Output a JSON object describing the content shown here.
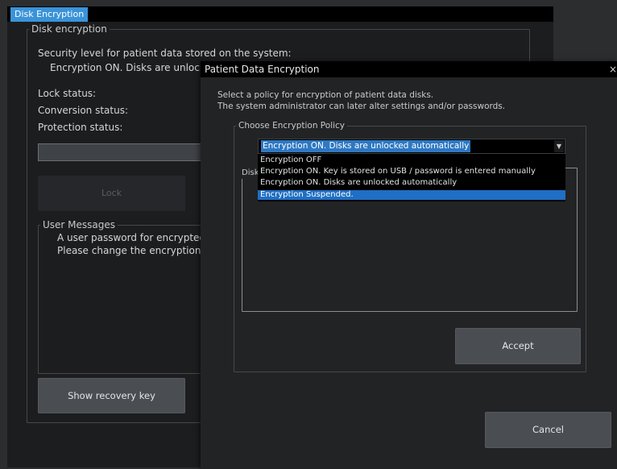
{
  "main_window": {
    "tab_label": "Disk Encryption",
    "group_title": "Disk encryption",
    "security_level_label": "Security level for patient data stored on the system:",
    "security_level_value": "Encryption ON. Disks are unlock",
    "lock_status_label": "Lock status:",
    "conversion_status_label": "Conversion status:",
    "protection_status_label": "Protection status:",
    "password_input_value": "",
    "lock_button": "Lock",
    "user_messages_title": "User Messages",
    "user_messages": [
      "A user password for encrypted",
      "Please change the encryption p"
    ],
    "recovery_button": "Show recovery key"
  },
  "dialog": {
    "title": "Patient Data Encryption",
    "close_glyph": "×",
    "description_line1": "Select a policy for encryption of patient data disks.",
    "description_line2": "The system administrator can later alter settings and/or passwords.",
    "policy_group_title": "Choose Encryption Policy",
    "policy_selected": "Encryption ON. Disks are unlocked automatically",
    "policy_options": [
      "Encryption OFF",
      "Encryption ON. Key is stored on USB / password is entered manually",
      "Encryption ON. Disks are unlocked automatically",
      "Encryption Suspended."
    ],
    "highlighted_option": 3,
    "inner_group_title_fragment": "Disk",
    "accept_button": "Accept",
    "cancel_button": "Cancel"
  },
  "colors": {
    "accent": "#3a93d9",
    "selection": "#1f6fc4",
    "background": "#1c1d1f"
  }
}
